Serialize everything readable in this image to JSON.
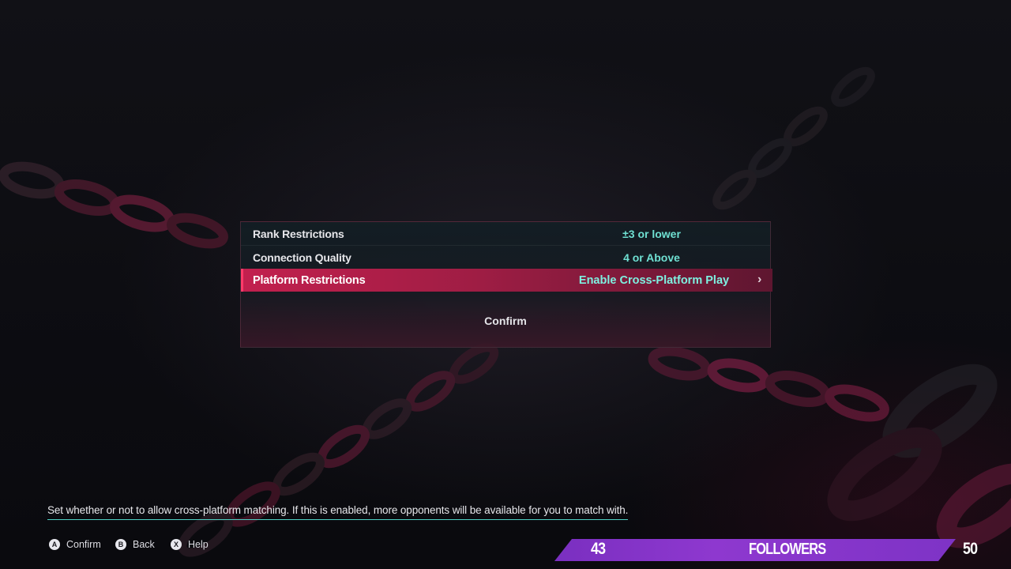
{
  "settings": {
    "rows": [
      {
        "label": "Rank Restrictions",
        "value": "±3 or lower"
      },
      {
        "label": "Connection Quality",
        "value": "4 or Above"
      },
      {
        "label": "Platform Restrictions",
        "value": "Enable Cross-Platform Play"
      }
    ],
    "selected_index": 2,
    "confirm_label": "Confirm"
  },
  "help_text": "Set whether or not to allow cross-platform matching. If this is enabled, more opponents will be available for you to match with.",
  "prompts": [
    {
      "button": "A",
      "label": "Confirm"
    },
    {
      "button": "B",
      "label": "Back"
    },
    {
      "button": "X",
      "label": "Help"
    }
  ],
  "followers": {
    "current": "43",
    "label": "FOLLOWERS",
    "goal": "50"
  },
  "colors": {
    "selection": "#c2204e",
    "value_text": "#6fe0d2",
    "followers_bar": "#8e38cf"
  },
  "icons": {
    "row_arrow": "chevron-right-icon"
  }
}
